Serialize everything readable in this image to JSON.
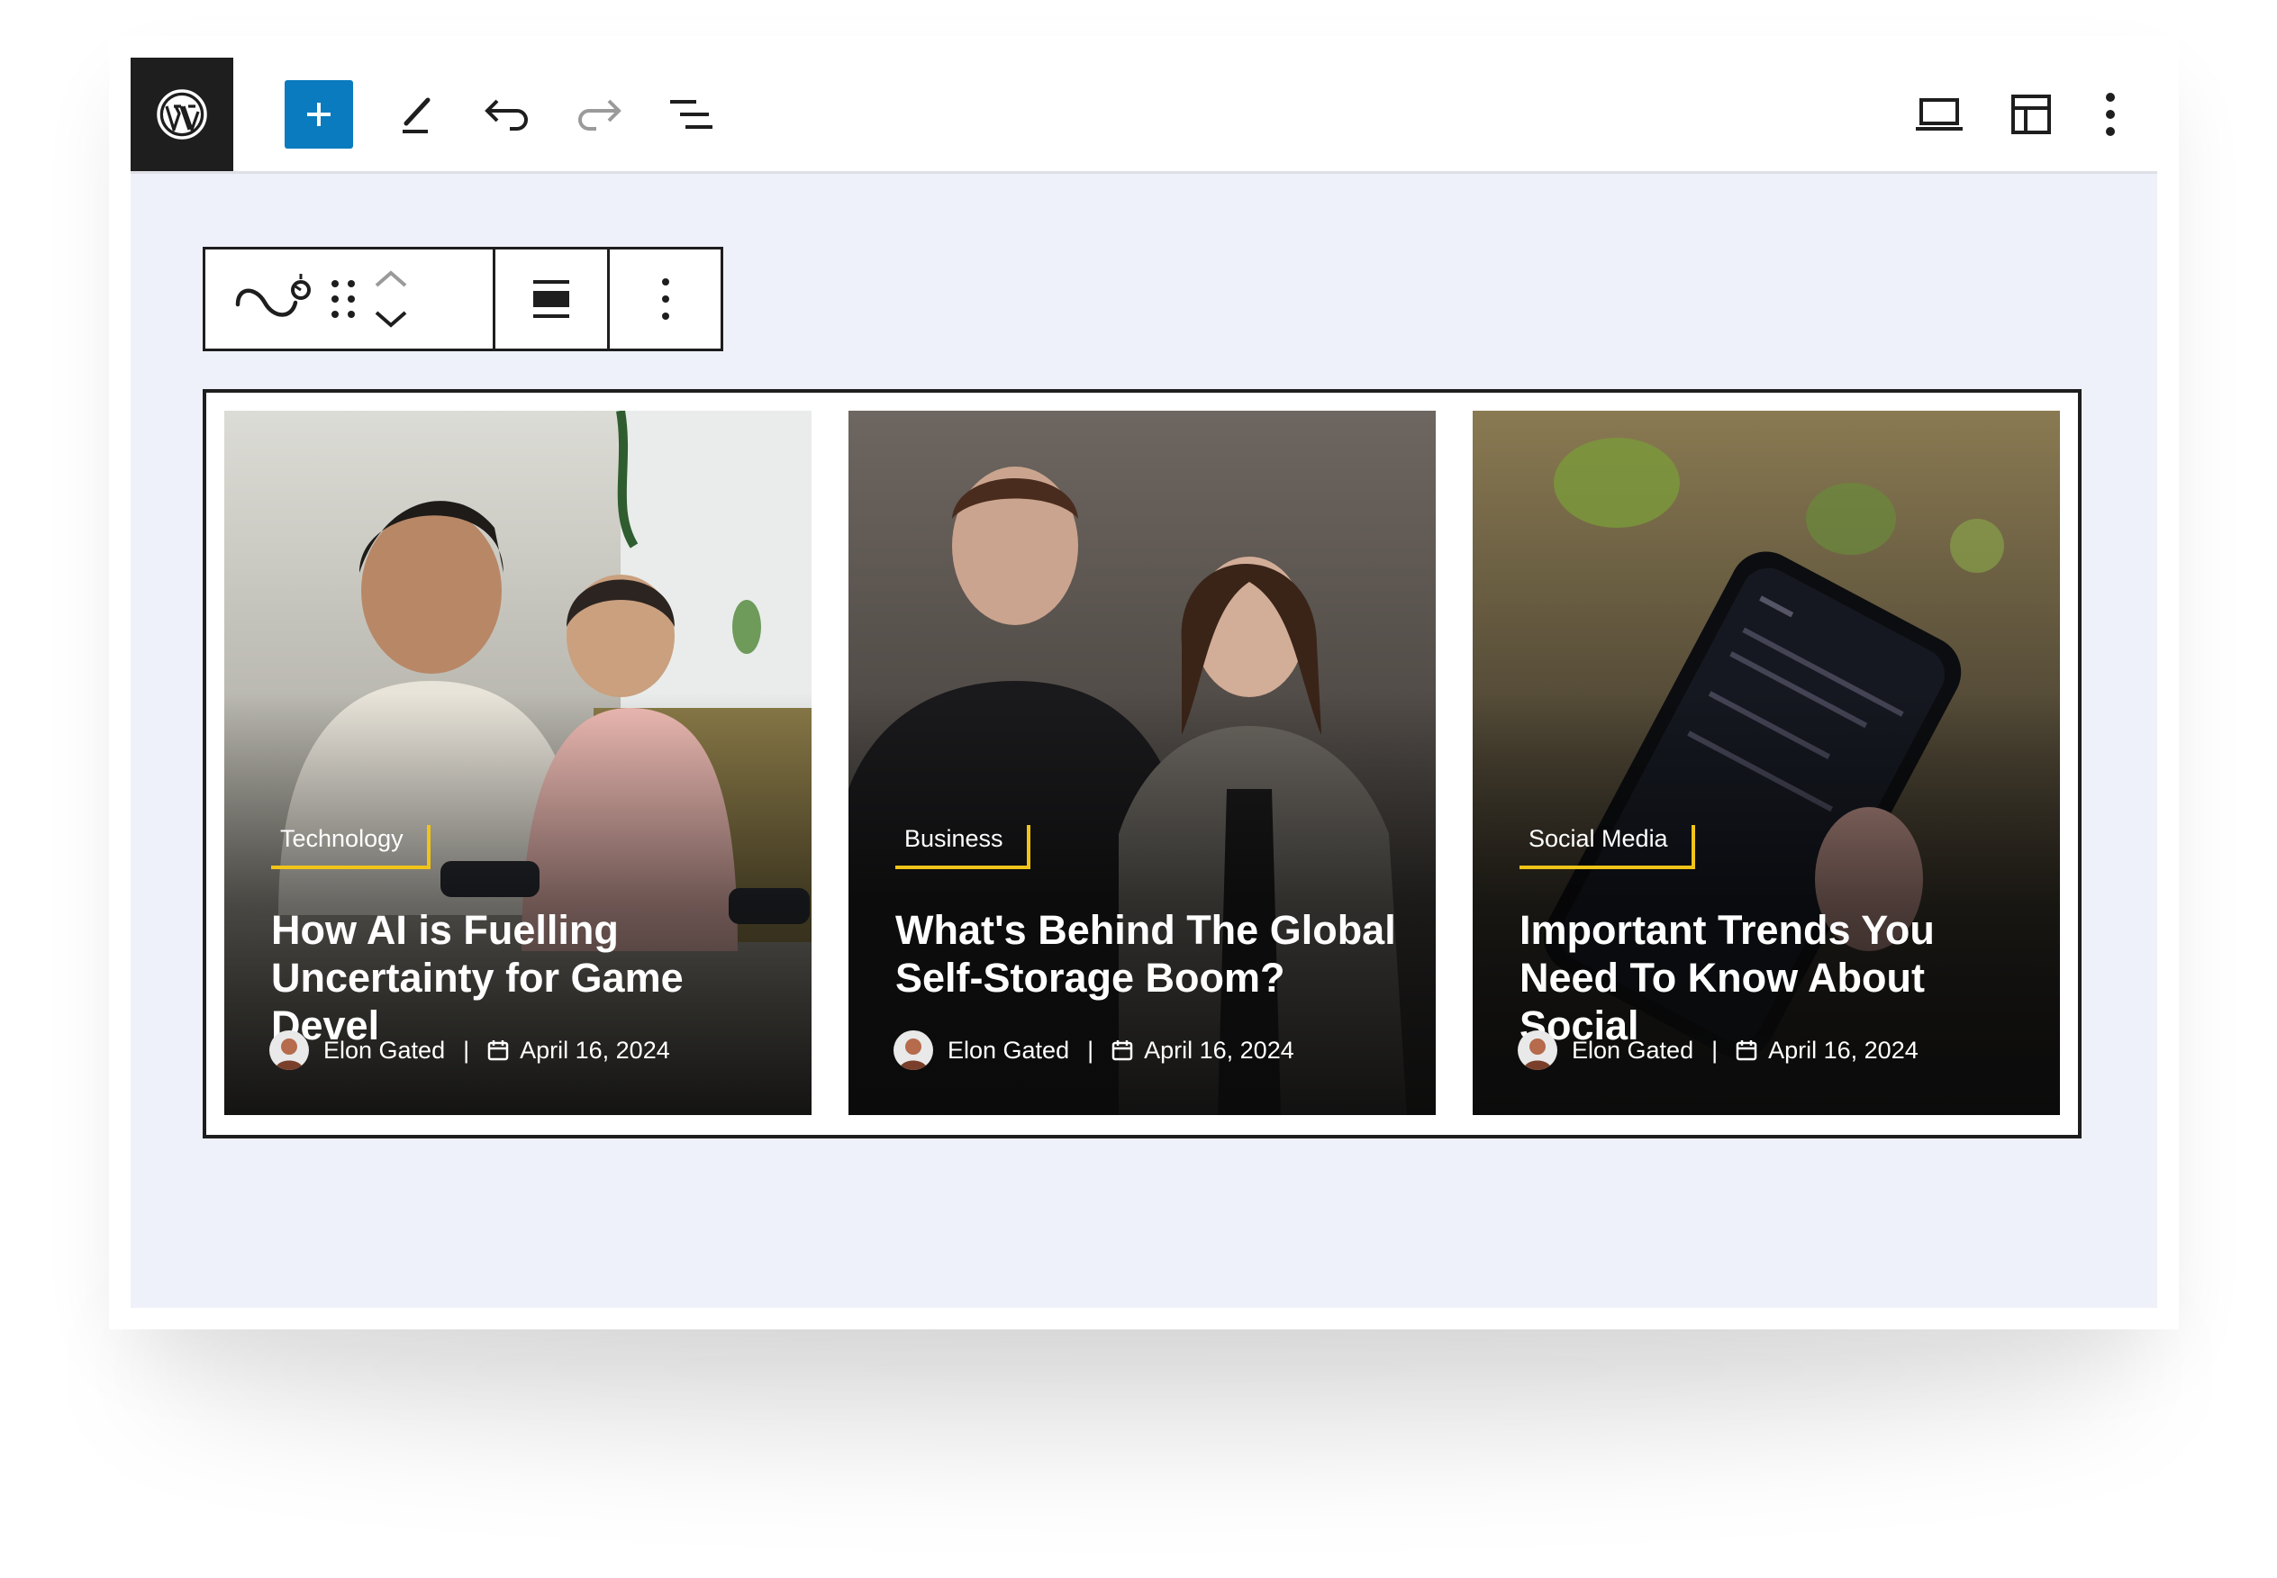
{
  "toolbar": {
    "logo_icon": "wordpress-logo",
    "add_icon": "plus-icon",
    "tools_icon": "pen-icon",
    "undo_icon": "undo-icon",
    "redo_icon": "redo-icon",
    "outline_icon": "list-view-icon",
    "view_icon": "laptop-icon",
    "layout_icon": "layout-icon",
    "options_icon": "more-vertical-icon"
  },
  "block_toolbar": {
    "block_icon": "block-type-icon",
    "drag_icon": "drag-handle-icon",
    "move_icon": "move-up-down-icon",
    "align_icon": "align-icon",
    "more_icon": "more-vertical-icon"
  },
  "posts": [
    {
      "category": "Technology",
      "title": "How AI is Fuelling Uncertainty for Game Devel",
      "author": "Elon Gated",
      "date": "April 16, 2024"
    },
    {
      "category": "Business",
      "title": "What's Behind The Global Self-Storage Boom?",
      "author": "Elon Gated",
      "date": "April 16, 2024"
    },
    {
      "category": "Social Media",
      "title": "Important Trends You Need To Know About Social",
      "author": "Elon Gated",
      "date": "April 16, 2024"
    }
  ],
  "meta_separator": "|",
  "colors": {
    "accent": "#f0c419",
    "wp_blue": "#0a7bbf",
    "canvas_bg": "#eef1fa",
    "dark": "#1e1e1e"
  }
}
